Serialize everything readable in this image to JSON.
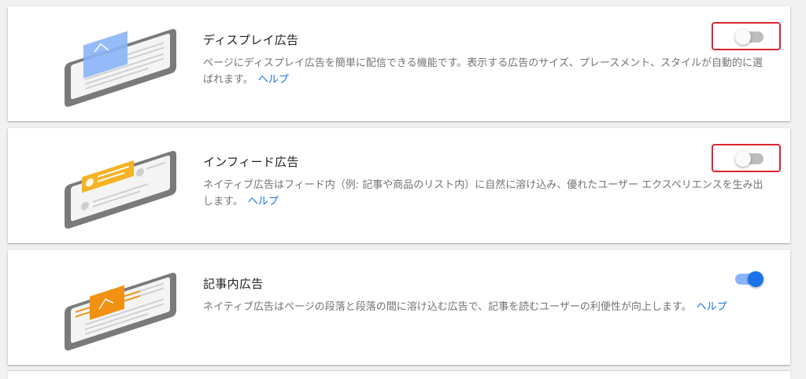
{
  "cards": [
    {
      "title": "ディスプレイ広告",
      "description": "ページにディスプレイ広告を簡単に配信できる機能です。表示する広告のサイズ、プレースメント、スタイルが自動的に選ばれます。",
      "help": "ヘルプ",
      "toggle_on": false,
      "highlighted": true
    },
    {
      "title": "インフィード広告",
      "description": "ネイティブ広告はフィード内（例: 記事や商品のリスト内）に自然に溶け込み、優れたユーザー エクスペリエンスを生み出します。",
      "help": "ヘルプ",
      "toggle_on": false,
      "highlighted": true
    },
    {
      "title": "記事内広告",
      "description": "ネイティブ広告はページの段落と段落の間に溶け込む広告で、記事を読むユーザーの利便性が向上します。",
      "help": "ヘルプ",
      "toggle_on": true,
      "highlighted": false
    }
  ],
  "colors": {
    "accent": "#1a73e8",
    "highlight_border": "#d9272e",
    "display_ad_blue": "#8ab4f8",
    "infeed_ad_yellow": "#f5b325",
    "inarticle_ad_orange": "#f29111"
  }
}
